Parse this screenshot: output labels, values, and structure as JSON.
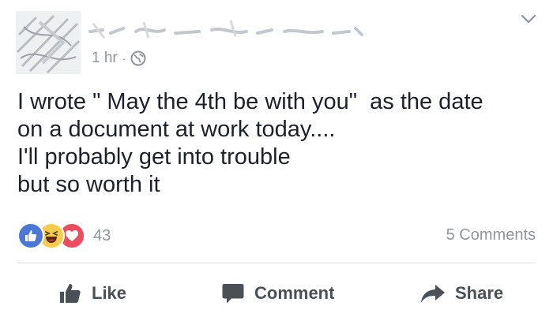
{
  "post": {
    "timestamp": "1 hr",
    "separator": "·",
    "privacy_icon": "globe-icon",
    "text_lines": [
      "I wrote \" May the 4th be with you\"  as the date",
      "on a document at work today....",
      "I'll probably get into trouble",
      "but so worth it"
    ]
  },
  "reactions": {
    "icons": [
      "like-icon",
      "haha-icon",
      "love-icon"
    ],
    "count": "43",
    "comments": "5 Comments"
  },
  "actions": {
    "like_label": "Like",
    "comment_label": "Comment",
    "share_label": "Share"
  },
  "colors": {
    "text": "#1d2129",
    "muted": "#90949c",
    "action": "#4b4f56",
    "like_blue": "#4a78d9",
    "haha_yellow": "#f8cc4a",
    "love_red": "#ef4b5e"
  }
}
